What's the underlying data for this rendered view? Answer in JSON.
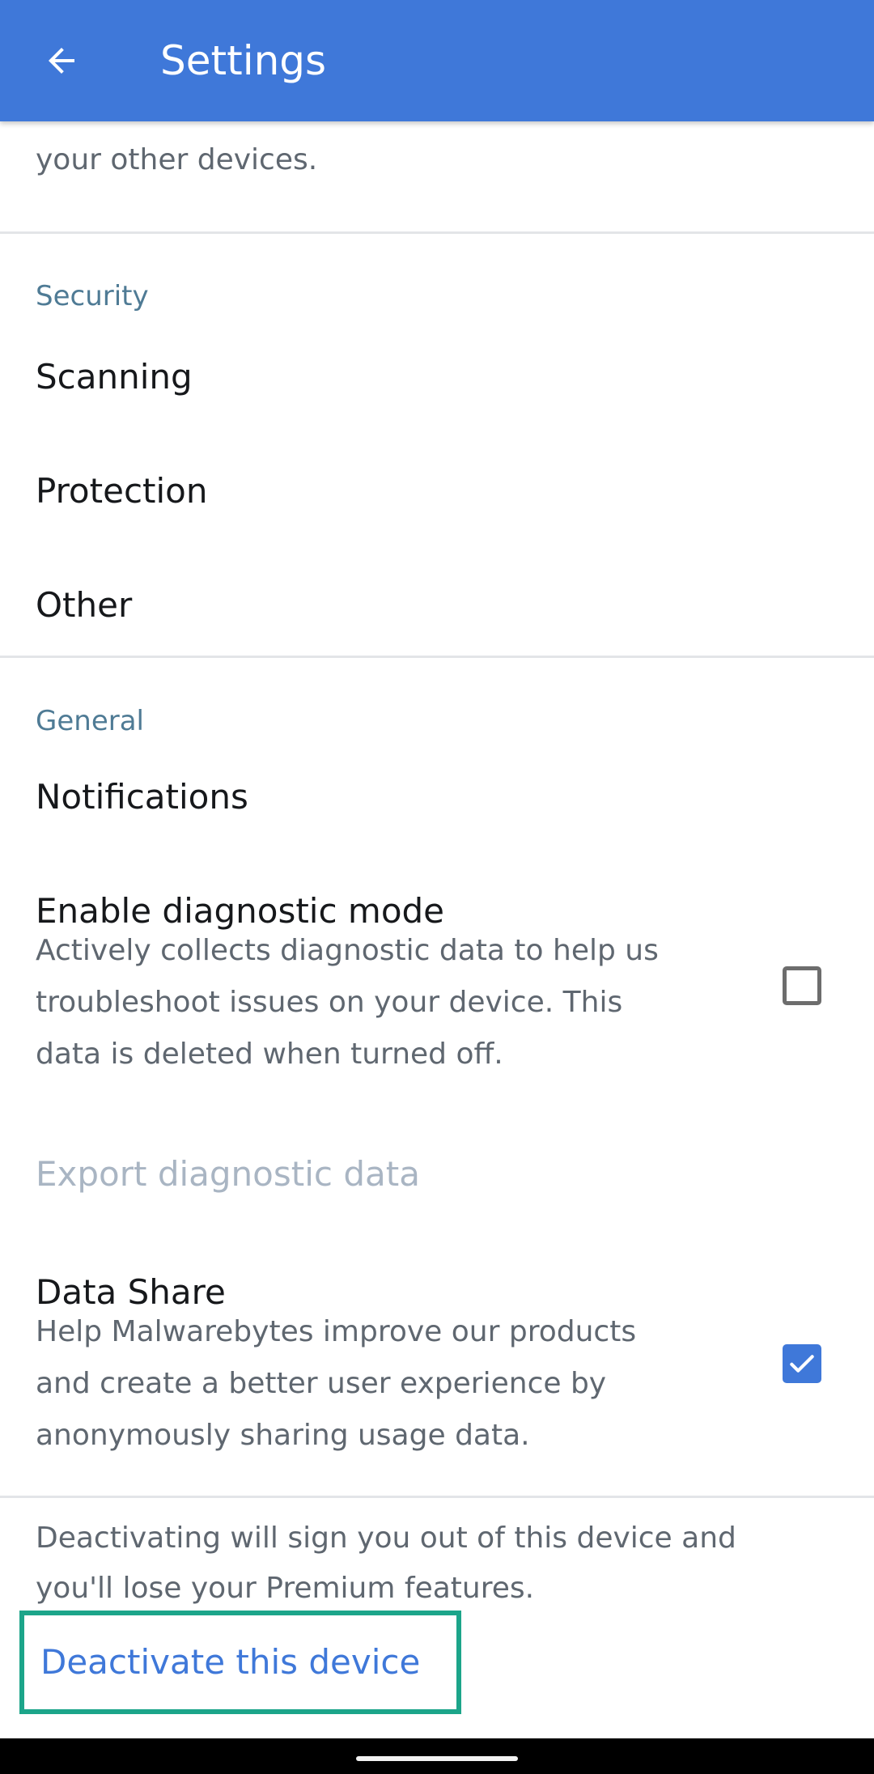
{
  "app_bar": {
    "title": "Settings",
    "back_icon": "arrow-left-icon",
    "background_color": "#3f78d9"
  },
  "top_description": "your other devices.",
  "sections": {
    "security": {
      "header": "Security",
      "items": [
        {
          "label": "Scanning"
        },
        {
          "label": "Protection"
        },
        {
          "label": "Other"
        }
      ]
    },
    "general": {
      "header": "General",
      "notifications": {
        "label": "Notifications"
      },
      "diagnostic_mode": {
        "title": "Enable diagnostic mode",
        "description_lines": [
          "Actively collects diagnostic data to help us",
          "troubleshoot issues on your device. This",
          "data is deleted when turned off."
        ],
        "checked": false
      },
      "export_diagnostic": {
        "label": "Export diagnostic data",
        "enabled": false
      },
      "data_share": {
        "title": "Data Share",
        "description_lines": [
          "Help Malwarebytes improve our products",
          "and create a better user experience by",
          "anonymously sharing usage data."
        ],
        "checked": true
      }
    }
  },
  "deactivate": {
    "description_lines": [
      "Deactivating will sign you out of this device and",
      "you'll lose your Premium features."
    ],
    "button_label": "Deactivate this device",
    "highlight_color": "#1ca58a"
  },
  "colors": {
    "accent": "#3f78d9",
    "section_header": "#4f7b95",
    "disabled_text": "#a9b5c3"
  }
}
